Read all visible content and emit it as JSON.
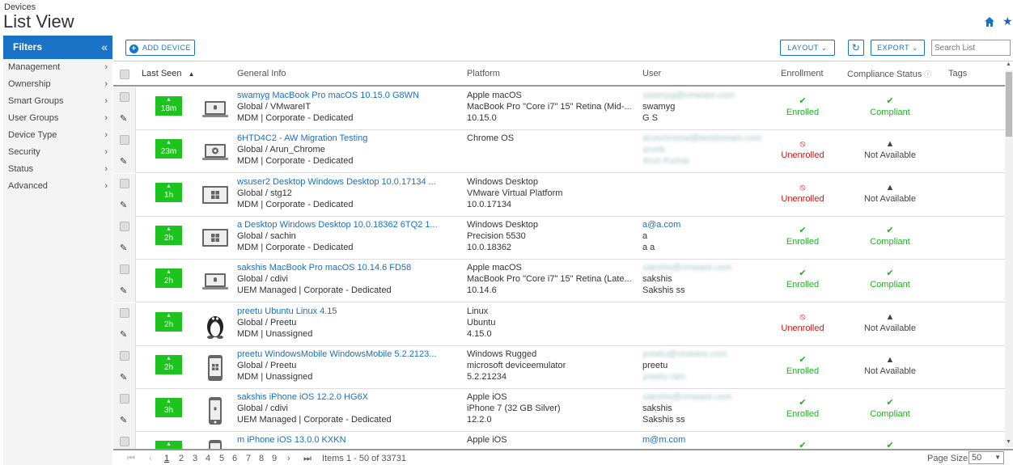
{
  "header": {
    "breadcrumb": "Devices",
    "title": "List View"
  },
  "sidebar": {
    "title": "Filters",
    "collapse": "«",
    "items": [
      {
        "label": "Management"
      },
      {
        "label": "Ownership"
      },
      {
        "label": "Smart Groups"
      },
      {
        "label": "User Groups"
      },
      {
        "label": "Device Type"
      },
      {
        "label": "Security"
      },
      {
        "label": "Status"
      },
      {
        "label": "Advanced"
      }
    ]
  },
  "toolbar": {
    "add_device": "ADD DEVICE",
    "layout": "LAYOUT",
    "export": "EXPORT",
    "search_placeholder": "Search List"
  },
  "columns": {
    "last_seen": "Last Seen",
    "general_info": "General Info",
    "platform": "Platform",
    "user": "User",
    "enrollment": "Enrollment",
    "compliance": "Compliance Status",
    "tags": "Tags"
  },
  "rows": [
    {
      "last_seen": "18m",
      "device_icon": "laptop-mac-icon",
      "name": "swamyg MacBook Pro macOS 10.15.0 G8WN",
      "group": "Global / VMwareIT",
      "mgmt": "MDM | Corporate - Dedicated",
      "platform": [
        "Apple macOS",
        "MacBook Pro \"Core i7\" 15\" Retina (Mid-...",
        "10.15.0"
      ],
      "user": [
        "swamyg@vmware.com",
        "swamyg",
        "G S"
      ],
      "user_blur": [
        true,
        false,
        false
      ],
      "enrollment": "Enrolled",
      "enrollment_status": "ok",
      "compliance": "Compliant",
      "compliance_status": "ok"
    },
    {
      "last_seen": "23m",
      "device_icon": "chromebook-icon",
      "name": "6HTD4C2 - AW Migration Testing",
      "group": "Global / Arun_Chrome",
      "mgmt": "MDM | Corporate - Dedicated",
      "platform": [
        "Chrome OS",
        "",
        ""
      ],
      "user": [
        "arunchrome@testdomain.com",
        "arunk",
        "Arun Kumar"
      ],
      "user_blur": [
        true,
        true,
        true
      ],
      "enrollment": "Unenrolled",
      "enrollment_status": "bad",
      "compliance": "Not Available",
      "compliance_status": "na"
    },
    {
      "last_seen": "1h",
      "device_icon": "windows-desktop-icon",
      "name": "wsuser2 Desktop Windows Desktop 10.0.17134 ...",
      "group": "Global / stg12",
      "mgmt": "MDM | Corporate - Dedicated",
      "platform": [
        "Windows Desktop",
        "VMware Virtual Platform",
        "10.0.17134"
      ],
      "user": [
        "",
        "",
        ""
      ],
      "user_blur": [
        false,
        false,
        false
      ],
      "enrollment": "Unenrolled",
      "enrollment_status": "bad",
      "compliance": "Not Available",
      "compliance_status": "na"
    },
    {
      "last_seen": "2h",
      "device_icon": "windows-desktop-icon",
      "name": "a Desktop Windows Desktop 10.0.18362 6TQ2 1...",
      "group": "Global / sachin",
      "mgmt": "MDM | Corporate - Dedicated",
      "platform": [
        "Windows Desktop",
        "Precision 5530",
        "10.0.18362"
      ],
      "user": [
        "a@a.com",
        "a",
        "a a"
      ],
      "user_blur": [
        false,
        false,
        false
      ],
      "user_link": true,
      "enrollment": "Enrolled",
      "enrollment_status": "ok",
      "compliance": "Compliant",
      "compliance_status": "ok"
    },
    {
      "last_seen": "2h",
      "device_icon": "laptop-mac-icon",
      "name": "sakshis MacBook Pro macOS 10.14.6 FD58",
      "group": "Global / cdivi",
      "mgmt": "UEM Managed | Corporate - Dedicated",
      "platform": [
        "Apple macOS",
        "MacBook Pro \"Core i7\" 15\" Retina (Late...",
        "10.14.6"
      ],
      "user": [
        "sakshis@vmware.com",
        "sakshis",
        "Sakshis ss"
      ],
      "user_blur": [
        true,
        false,
        false
      ],
      "enrollment": "Enrolled",
      "enrollment_status": "ok",
      "compliance": "Compliant",
      "compliance_status": "ok"
    },
    {
      "last_seen": "2h",
      "device_icon": "linux-penguin-icon",
      "name": "preetu Ubuntu Linux 4.15",
      "group": "Global / Preetu",
      "mgmt": "MDM | Unassigned",
      "platform": [
        "Linux",
        "Ubuntu",
        "4.15.0"
      ],
      "user": [
        "",
        "",
        ""
      ],
      "user_blur": [
        false,
        false,
        false
      ],
      "enrollment": "Unenrolled",
      "enrollment_status": "bad",
      "compliance": "Not Available",
      "compliance_status": "na"
    },
    {
      "last_seen": "2h",
      "device_icon": "windows-phone-icon",
      "name": "preetu WindowsMobile WindowsMobile 5.2.2123...",
      "group": "Global / Preetu",
      "mgmt": "MDM | Unassigned",
      "platform": [
        "Windows Rugged",
        "microsoft deviceemulator",
        "5.2.21234"
      ],
      "user": [
        "preetu@vmware.com",
        "preetu",
        "preetu ram"
      ],
      "user_blur": [
        true,
        false,
        true
      ],
      "enrollment": "Enrolled",
      "enrollment_status": "ok",
      "compliance": "Not Available",
      "compliance_status": "na"
    },
    {
      "last_seen": "3h",
      "device_icon": "iphone-icon",
      "name": "sakshis iPhone iOS 12.2.0 HG6X",
      "group": "Global / cdivi",
      "mgmt": "UEM Managed | Corporate - Dedicated",
      "platform": [
        "Apple iOS",
        "iPhone 7 (32 GB Silver)",
        "12.2.0"
      ],
      "user": [
        "sakshis@vmware.com",
        "sakshis",
        "Sakshis ss"
      ],
      "user_blur": [
        true,
        false,
        false
      ],
      "enrollment": "Enrolled",
      "enrollment_status": "ok",
      "compliance": "Compliant",
      "compliance_status": "ok"
    },
    {
      "last_seen": "",
      "device_icon": "iphone-icon",
      "name": "m iPhone iOS 13.0.0 KXKN",
      "group": "",
      "mgmt": "",
      "platform": [
        "Apple iOS",
        "",
        ""
      ],
      "user": [
        "m@m.com",
        "",
        ""
      ],
      "user_blur": [
        false,
        false,
        false
      ],
      "user_link": true,
      "enrollment": "",
      "enrollment_status": "ok",
      "compliance": "",
      "compliance_status": "ok"
    }
  ],
  "pager": {
    "first": "⏮",
    "prev": "‹",
    "pages": [
      "1",
      "2",
      "3",
      "4",
      "5",
      "6",
      "7",
      "8",
      "9"
    ],
    "next": "›",
    "last": "⏭",
    "summary": "Items 1 - 50 of 33731",
    "page_size_label": "Page Size:",
    "page_size": "50"
  },
  "colors": {
    "accent": "#1a73c7",
    "green": "#1ec41e",
    "red": "#d11111"
  }
}
